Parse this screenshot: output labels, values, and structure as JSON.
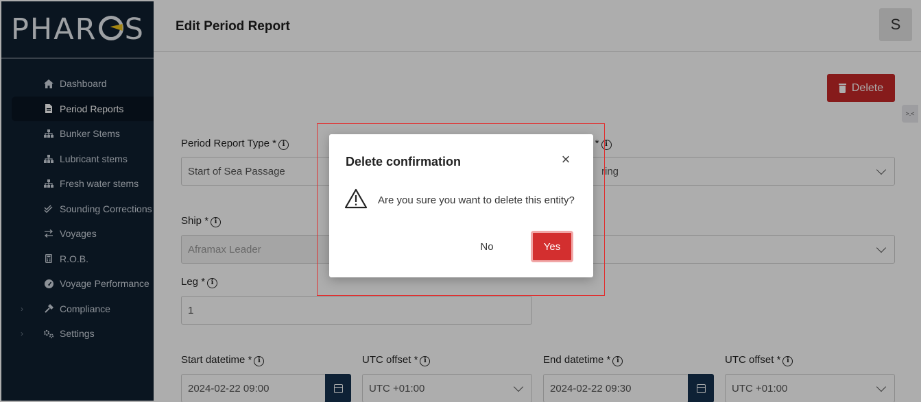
{
  "app": {
    "brand": "PHAROS",
    "page_title": "Edit Period Report",
    "user_initial": "S"
  },
  "sidebar": {
    "items": [
      {
        "label": "Dashboard",
        "icon": "home-icon"
      },
      {
        "label": "Period Reports",
        "icon": "document-icon",
        "active": true
      },
      {
        "label": "Bunker Stems",
        "icon": "hierarchy-icon"
      },
      {
        "label": "Lubricant stems",
        "icon": "hierarchy-icon"
      },
      {
        "label": "Fresh water stems",
        "icon": "hierarchy-icon"
      },
      {
        "label": "Sounding Corrections",
        "icon": "double-check-icon"
      },
      {
        "label": "Voyages",
        "icon": "swap-arrows-icon"
      },
      {
        "label": "R.O.B.",
        "icon": "calculator-icon"
      },
      {
        "label": "Voyage Performance",
        "icon": "gauge-icon"
      },
      {
        "label": "Compliance",
        "icon": "hammer-icon",
        "expandable": true
      },
      {
        "label": "Settings",
        "icon": "cogs-icon",
        "expandable": true
      }
    ]
  },
  "toolbar": {
    "delete_label": "Delete"
  },
  "form": {
    "period_report_type": {
      "label": "Period Report Type *",
      "value": "Start of Sea Passage"
    },
    "status": {
      "label_fragment": "s *",
      "value_fragment": "ring"
    },
    "ship": {
      "label": "Ship *",
      "value": "Aframax Leader"
    },
    "leg": {
      "label": "Leg *",
      "value": "1"
    },
    "start_datetime": {
      "label": "Start datetime *",
      "value": "2024-02-22 09:00"
    },
    "start_utc_offset": {
      "label": "UTC offset *",
      "value": "UTC +01:00"
    },
    "end_datetime": {
      "label": "End datetime *",
      "value": "2024-02-22 09:30"
    },
    "end_utc_offset": {
      "label": "UTC offset *",
      "value": "UTC +01:00"
    }
  },
  "modal": {
    "title": "Delete confirmation",
    "message": "Are you sure you want to delete this entity?",
    "no_label": "No",
    "yes_label": "Yes"
  },
  "colors": {
    "sidebar_bg": "#0f1f30",
    "danger": "#c62828",
    "calendar_button": "#15324f",
    "highlight_border": "#e03131"
  }
}
